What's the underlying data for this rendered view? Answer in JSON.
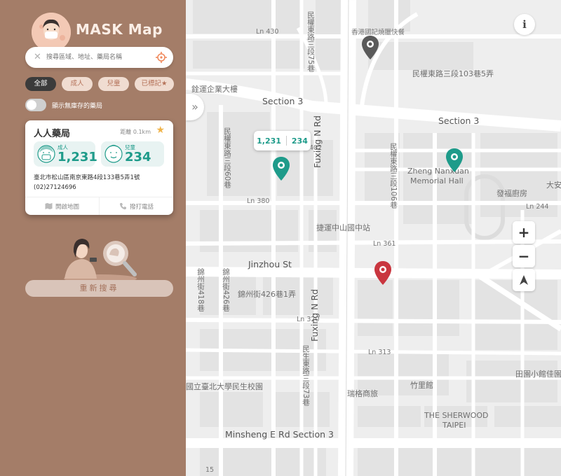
{
  "app": {
    "title": "MASK Map"
  },
  "search": {
    "placeholder": "搜尋區域、地址、藥局名稱",
    "clear_icon": "close-icon",
    "locate_icon": "crosshair-icon"
  },
  "filters": [
    {
      "label": "全部",
      "active": true
    },
    {
      "label": "成人",
      "active": false
    },
    {
      "label": "兒童",
      "active": false
    },
    {
      "label": "已標記★",
      "active": false
    }
  ],
  "toggle": {
    "label": "顯示無庫存的藥局",
    "on": false
  },
  "pharmacy_card": {
    "name": "人人藥局",
    "distance": "距離 0.1km",
    "adult": {
      "label": "成人",
      "count": "1,231"
    },
    "child": {
      "label": "兒童",
      "count": "234"
    },
    "address": "臺北市松山區南京東路4段133巷5弄1號",
    "phone": "(02)27124696",
    "actions": {
      "map": "開啟地圖",
      "call": "撥打電話"
    }
  },
  "refresh": {
    "label": "重新搜尋"
  },
  "map": {
    "bubble": {
      "adult": "1,231",
      "child": "234"
    },
    "labels": {
      "ln430": "Ln 430",
      "hongkong": "香港國記燒臘快餐",
      "minquan_ln103": "民權東路三段103巷5弄",
      "quanyun": "銓運企業大樓",
      "section3_a": "Section 3",
      "section3_b": "Section 3",
      "n402": "402",
      "zhengnanxuan": "Zheng Nanxuan",
      "memorial": "Memorial Hall",
      "fayuan": "發福廚房",
      "dayu": "大安",
      "ln244": "Ln 244",
      "ln380": "Ln 380",
      "zhongshan_station": "捷運中山國中站",
      "ln361": "Ln 361",
      "jinzhou": "Jinzhou St",
      "jinzhou426": "錦州街426巷1弄",
      "ln320": "Ln 320",
      "ln313": "Ln 313",
      "tianyuan": "田園小館佳園",
      "ntpu": "國立臺北大學民生校園",
      "zhulizhai": "竹里館",
      "ruige": "瑞格商旅",
      "sherwood": "THE SHERWOOD",
      "taipei": "TAIPEI",
      "minsheng": "Minsheng E Rd Section 3",
      "fuxing_a": "Fuxing N Rd",
      "fuxing_b": "Fuxing N Rd",
      "v_minquan75": "民權東路三段75巷",
      "v_minquan60": "民權東路三段60巷",
      "v_minquan106": "民權東路三段106巷",
      "v_jinzhou418": "錦州街418巷",
      "v_jinzhou426": "錦州街426巷",
      "v_minsheng73": "民生東路三段73巷",
      "n15": "15"
    },
    "controls": {
      "info": "i",
      "zoom_in": "+",
      "zoom_out": "−"
    }
  }
}
